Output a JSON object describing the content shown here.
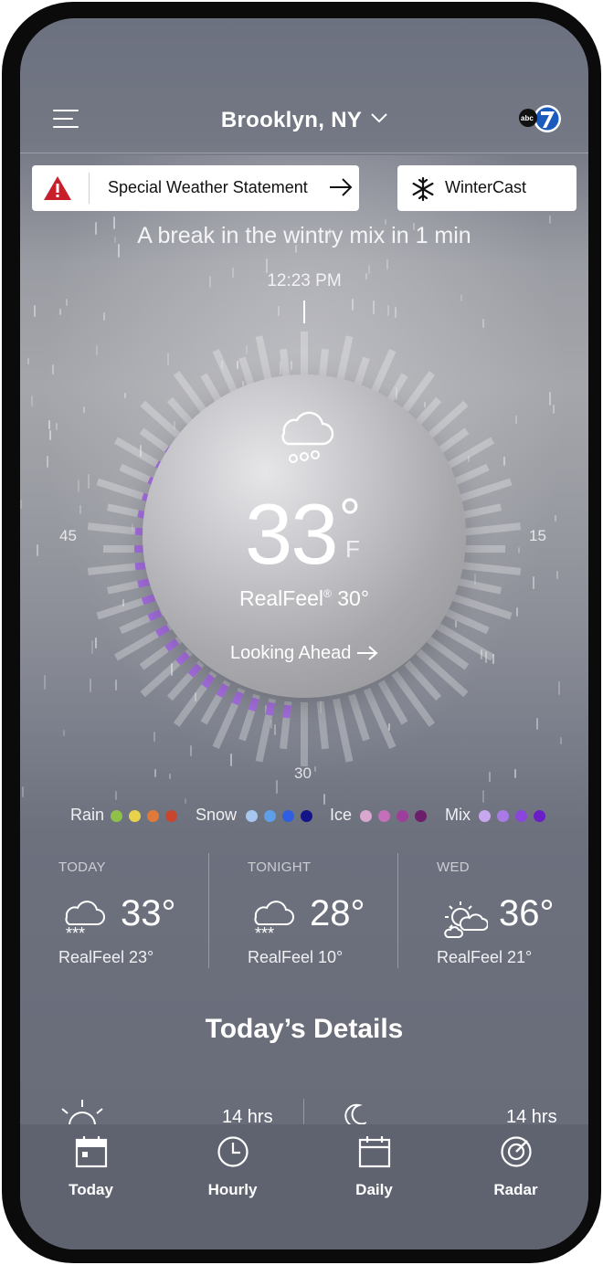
{
  "header": {
    "location": "Brooklyn, NY",
    "logo_text": "abc7"
  },
  "alerts": {
    "statement_label": "Special Weather Statement",
    "wintercast_label": "WinterCast"
  },
  "nowcast": {
    "headline": "A break in the wintry mix in 1 min",
    "time": "12:23 PM",
    "dial_labels": {
      "left": "45",
      "right": "15",
      "bottom": "30"
    }
  },
  "current": {
    "temp": "33",
    "degree": "°",
    "unit": "F",
    "realfeel_prefix": "RealFeel",
    "realfeel_mark": "®",
    "realfeel_value": " 30°",
    "looking_ahead": "Looking Ahead"
  },
  "legend": [
    {
      "label": "Rain",
      "colors": [
        "#8fc04a",
        "#e8d24c",
        "#e0793a",
        "#c8462e"
      ]
    },
    {
      "label": "Snow",
      "colors": [
        "#a7c7ee",
        "#5f9ee8",
        "#2f5fe0",
        "#14148a"
      ]
    },
    {
      "label": "Ice",
      "colors": [
        "#d9a8cf",
        "#c46fb9",
        "#9d3f9a",
        "#6b1e6a"
      ]
    },
    {
      "label": "Mix",
      "colors": [
        "#c7a8ee",
        "#a97ae6",
        "#8a45dc",
        "#6a1ec8"
      ]
    }
  ],
  "forecast": [
    {
      "day": "TODAY",
      "icon": "snow-cloud-icon",
      "temp": "33°",
      "realfeel": "RealFeel 23°"
    },
    {
      "day": "TONIGHT",
      "icon": "snow-cloud-icon",
      "temp": "28°",
      "realfeel": "RealFeel 10°"
    },
    {
      "day": "WED",
      "icon": "partly-cloudy-sun-icon",
      "temp": "36°",
      "realfeel": "RealFeel 21°"
    }
  ],
  "details": {
    "title": "Today’s Details",
    "daylight_hours": "14 hrs",
    "moon_hours": "14 hrs"
  },
  "tabs": [
    {
      "label": "Today",
      "icon": "calendar-today-icon"
    },
    {
      "label": "Hourly",
      "icon": "clock-icon"
    },
    {
      "label": "Daily",
      "icon": "calendar-icon"
    },
    {
      "label": "Radar",
      "icon": "radar-icon"
    }
  ],
  "colors": {
    "precip_mix": "#a56ce0",
    "tab_bar": "#5f6370",
    "alert_red": "#c8202a"
  }
}
